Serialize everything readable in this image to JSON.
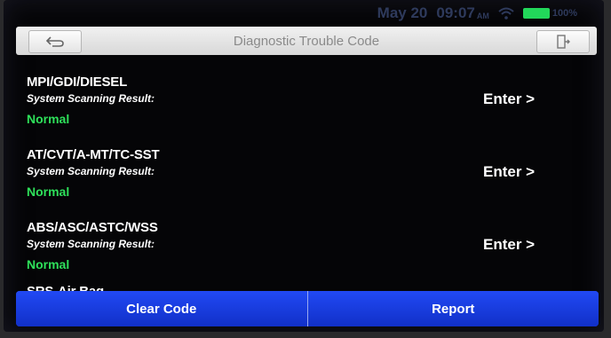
{
  "status_bar": {
    "date": "May 20",
    "time": "09:07",
    "ampm": "AM",
    "battery": "100%",
    "battery_color": "#22d85a"
  },
  "header": {
    "title": "Diagnostic Trouble Code",
    "back_icon": "back-arrow-icon",
    "exit_icon": "exit-door-icon"
  },
  "systems": [
    {
      "name": "MPI/GDI/DIESEL",
      "label": "System Scanning Result:",
      "status": "Normal",
      "action": "Enter >"
    },
    {
      "name": "AT/CVT/A-MT/TC-SST",
      "label": "System Scanning Result:",
      "status": "Normal",
      "action": "Enter >"
    },
    {
      "name": "ABS/ASC/ASTC/WSS",
      "label": "System Scanning Result:",
      "status": "Normal",
      "action": "Enter >"
    },
    {
      "name": "SRS-Air Bag"
    }
  ],
  "footer": {
    "clear_label": "Clear Code",
    "report_label": "Report"
  },
  "colors": {
    "normal_status": "#2ee05a",
    "footer_button": "#1a3bd8"
  }
}
